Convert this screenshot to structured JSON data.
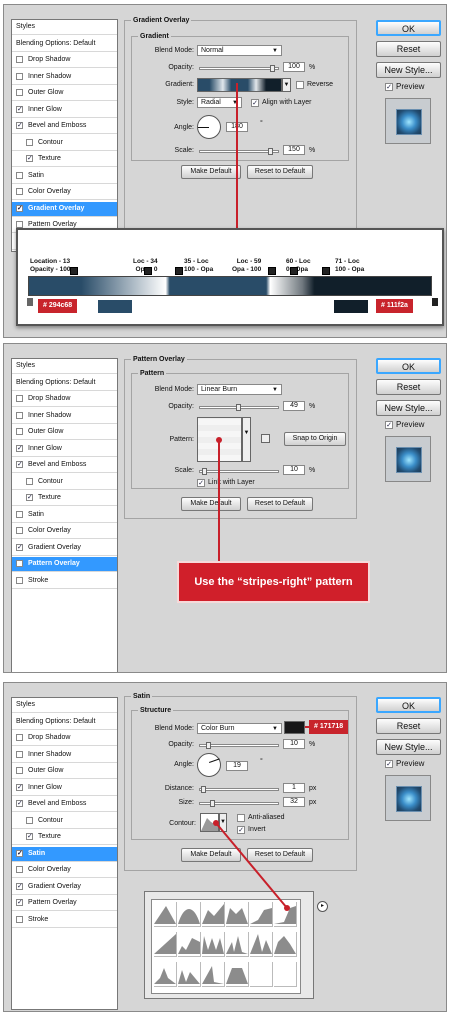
{
  "sidebar_items": [
    "Styles",
    "Blending Options: Default",
    "Drop Shadow",
    "Inner Shadow",
    "Outer Glow",
    "Inner Glow",
    "Bevel and Emboss",
    "Contour",
    "Texture",
    "Satin",
    "Color Overlay",
    "Gradient Overlay",
    "Pattern Overlay",
    "Stroke"
  ],
  "buttons": {
    "ok": "OK",
    "reset": "Reset",
    "new_style": "New Style...",
    "preview": "Preview",
    "make_default": "Make Default",
    "reset_to_default": "Reset to Default",
    "snap_to_origin": "Snap to Origin"
  },
  "units": {
    "percent": "%",
    "degree": "°",
    "px": "px"
  },
  "panel1": {
    "section": "Gradient Overlay",
    "group": "Gradient",
    "blend_mode_label": "Blend Mode:",
    "blend_mode": "Normal",
    "opacity_label": "Opacity:",
    "opacity": "100",
    "opacity_level": 100,
    "gradient_label": "Gradient:",
    "reverse_label": "Reverse",
    "reverse_checked": false,
    "style_label": "Style:",
    "style": "Radial",
    "align_label": "Align with Layer",
    "align_checked": true,
    "angle_label": "Angle:",
    "angle": "180",
    "scale_label": "Scale:",
    "scale": "150",
    "scale_level": 150,
    "checked": [
      false,
      false,
      false,
      true,
      true,
      false,
      true,
      false,
      false,
      true
    ],
    "zoom": {
      "stops": [
        {
          "line1": "Location - 13",
          "line2": "Opacity - 100"
        },
        {
          "line1": "Loc - 34",
          "line2": "Opa - 0"
        },
        {
          "line1": "35 - Loc",
          "line2": "100 - Opa"
        },
        {
          "line1": "Loc - 59",
          "line2": "Opa - 100"
        },
        {
          "line1": "60 - Loc",
          "line2": "0 - Opa"
        },
        {
          "line1": "71 - Loc",
          "line2": "100 - Opa"
        }
      ],
      "color_left": "# 294c68",
      "color_right": "# 111f2a",
      "swatch_left": "#294c68",
      "swatch_right": "#111f2a"
    }
  },
  "panel2": {
    "section": "Pattern Overlay",
    "group": "Pattern",
    "blend_mode_label": "Blend Mode:",
    "blend_mode": "Linear Burn",
    "opacity_label": "Opacity:",
    "opacity": "49",
    "opacity_level": 49,
    "pattern_label": "Pattern:",
    "scale_label": "Scale:",
    "scale": "10",
    "scale_level": 10,
    "link_label": "Link with Layer",
    "link_checked": true,
    "checked": [
      false,
      false,
      false,
      true,
      true,
      false,
      true,
      false,
      false,
      true
    ],
    "callout": "Use the “stripes-right” pattern"
  },
  "panel3": {
    "section": "Satin",
    "group": "Structure",
    "blend_mode_label": "Blend Mode:",
    "blend_mode": "Color Burn",
    "color_tag": "# 171718",
    "color_hex": "#171718",
    "opacity_label": "Opacity:",
    "opacity": "10",
    "opacity_level": 10,
    "angle_label": "Angle:",
    "angle": "19",
    "distance_label": "Distance:",
    "distance": "1",
    "size_label": "Size:",
    "size": "32",
    "contour_label": "Contour:",
    "anti_aliased_label": "Anti-aliased",
    "anti_aliased_checked": false,
    "invert_label": "Invert",
    "invert_checked": true,
    "checked": [
      false,
      false,
      false,
      true,
      true,
      false,
      true,
      true,
      false,
      true,
      true,
      false
    ],
    "contour_count": 18
  },
  "colors": {
    "accent": "#3399ff",
    "red": "#c8242c"
  }
}
